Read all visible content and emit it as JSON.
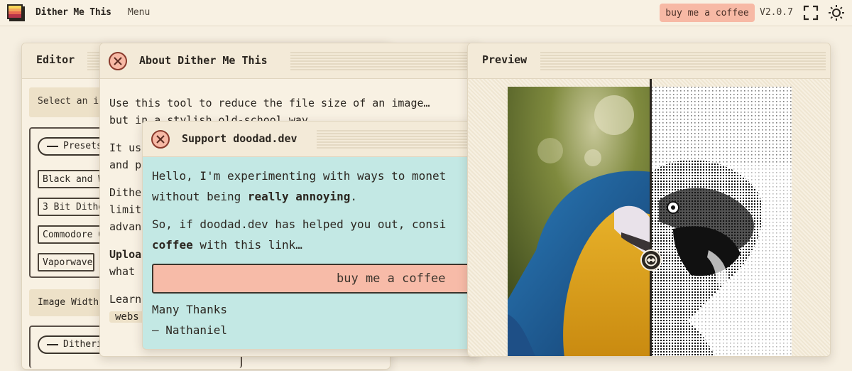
{
  "app": {
    "title": "Dither Me This",
    "menu_label": "Menu",
    "coffee_label": "buy me a coffee",
    "version": "V2.0.7"
  },
  "editor": {
    "title": "Editor",
    "select_text": "Select an i",
    "presets_label": "Presets",
    "presets": [
      "Black and W",
      "3 Bit Dithe",
      "Commodore 6",
      "Vaporwave"
    ],
    "image_width_label": "Image Width",
    "dithering_label": "Ditheri"
  },
  "about": {
    "title": "About Dither Me This",
    "line1": "Use this tool to reduce the file size of an image…",
    "line2": "but in a stylish old-school way.",
    "p2a": "It us",
    "p2b": "and p",
    "p3a": "Dithe",
    "p3b": "limit",
    "p3c": "advan",
    "p4a": "Uploa",
    "p4b": "what",
    "p5a": "Learn",
    "p5b": "webs"
  },
  "support": {
    "title": "Support doodad.dev",
    "line1": "Hello, I'm experimenting with ways to monet",
    "line2_pre": "without being ",
    "line2_bold": "really annoying",
    "line2_post": ".",
    "line3": "So, if doodad.dev has helped you out, consi",
    "line4_bold": "coffee",
    "line4_post": " with this link…",
    "button_label": "buy me a coffee",
    "thanks": "Many Thanks",
    "signature": "— Nathaniel"
  },
  "preview": {
    "title": "Preview"
  },
  "colors": {
    "background": "#f6efe1",
    "accent_coffee": "#f7b9a5",
    "support_bg": "#c3e8e4",
    "text": "#2b2620"
  }
}
